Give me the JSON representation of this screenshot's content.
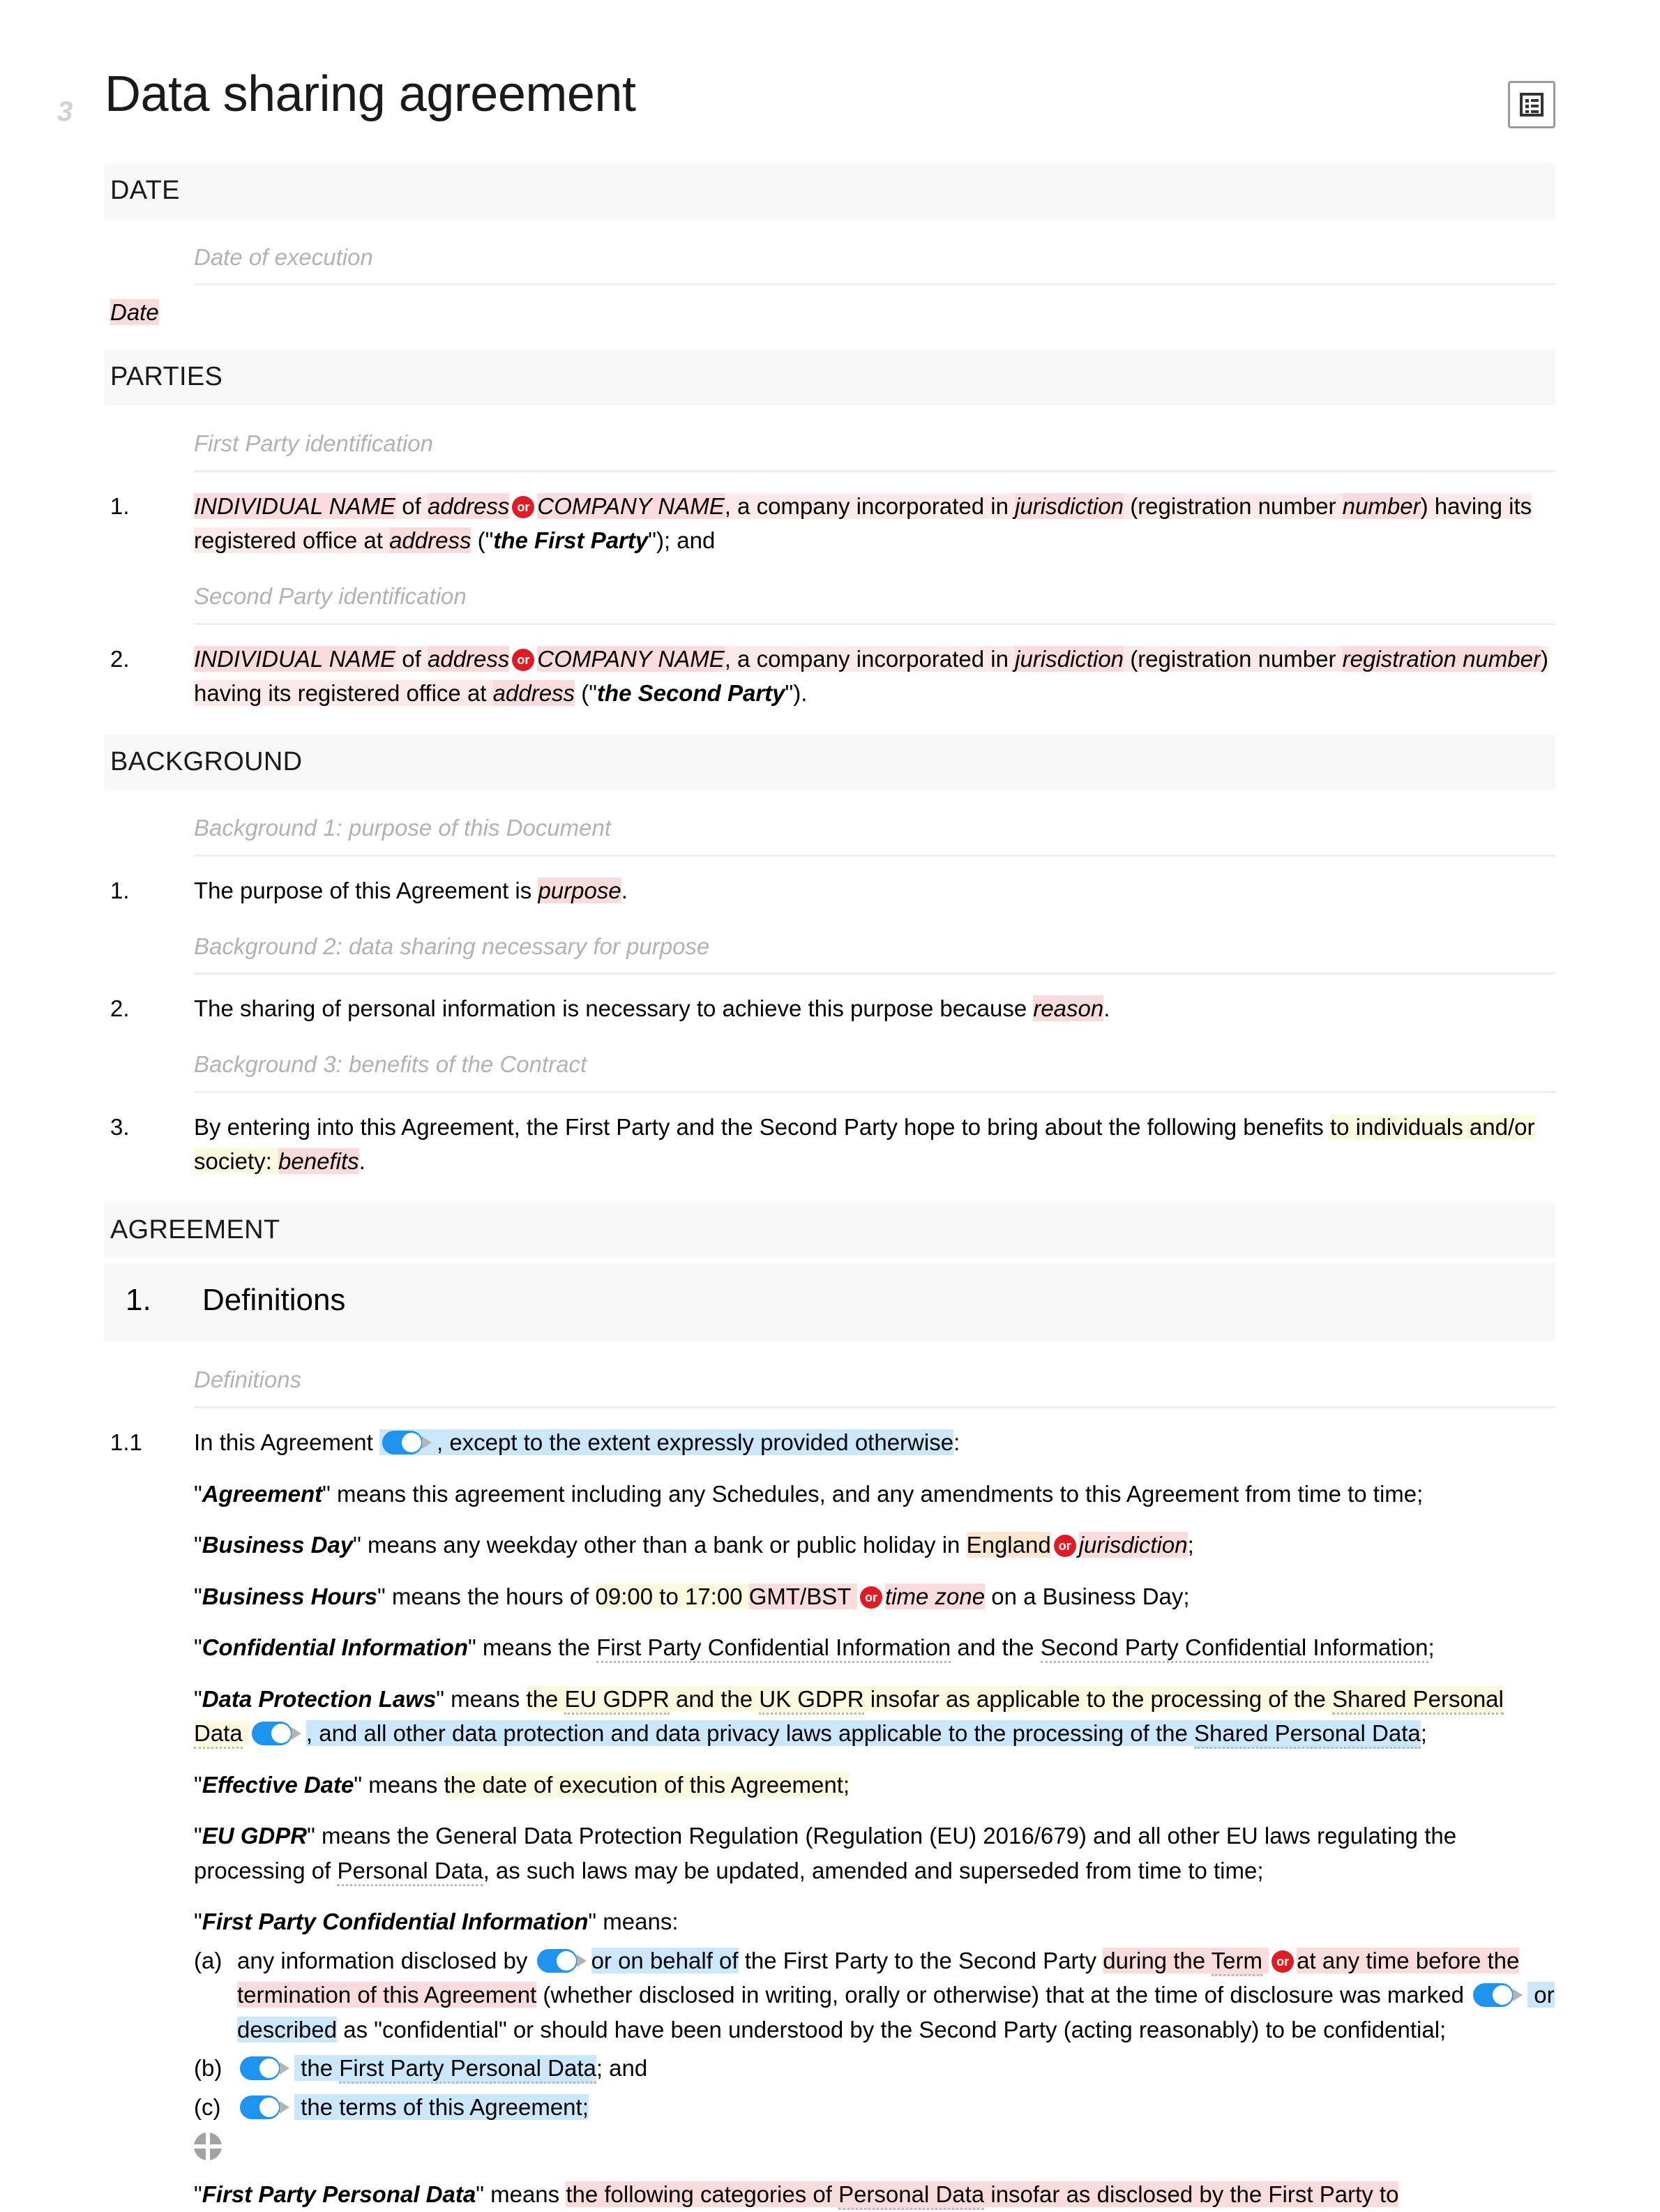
{
  "document": {
    "page_number_margin": "3",
    "title": "Data sharing agreement",
    "header_icon": "document-list-icon"
  },
  "colors": {
    "accent_blue": "#1e93f0",
    "or_badge_red": "#e01b22",
    "highlight_pink": "#fadcdc",
    "highlight_pink_light": "#fce9e9",
    "highlight_yellow": "#fbfadf",
    "highlight_orange": "#fbe6d0",
    "highlight_blue": "#cbe7fb",
    "band_grey": "#f8f8f8",
    "comment_grey": "#b2b2b2"
  },
  "sections": {
    "date": {
      "band": "DATE",
      "comment": "Date of execution",
      "value": "Date"
    },
    "parties": {
      "band": "PARTIES",
      "first_party": {
        "comment": "First Party identification",
        "marker": "1.",
        "p1": "INDIVIDUAL NAME",
        "p2": " of ",
        "p3": "address",
        "or": "or",
        "p4": "COMPANY NAME",
        "p5": ", a company incorporated in ",
        "p6": "jurisdiction",
        "p7": " (registration number ",
        "p8": "number",
        "p9": ")",
        "p10": " having its registered office at ",
        "p11": "address",
        "p12": " (\"",
        "p13": "the First Party",
        "p14": "\"); and"
      },
      "second_party": {
        "comment": "Second Party identification",
        "marker": "2.",
        "p1": "INDIVIDUAL NAME",
        "p2": " of ",
        "p3": "address",
        "or": "or",
        "p4": "COMPANY NAME",
        "p5": ", a company incorporated in ",
        "p6": "jurisdiction",
        "p7": " (registration number ",
        "p8": "registration number",
        "p9": ")",
        "p10": " having its registered office at ",
        "p11": "address",
        "p12": " (\"",
        "p13": "the Second Party",
        "p14": "\")."
      }
    },
    "background": {
      "band": "BACKGROUND",
      "items": [
        {
          "comment": "Background 1: purpose of this Document",
          "marker": "1.",
          "pre": "The purpose of this Agreement is ",
          "placeholder": "purpose",
          "post": "."
        },
        {
          "comment": "Background 2: data sharing necessary for purpose",
          "marker": "2.",
          "pre": "The sharing of personal information is necessary to achieve this purpose because ",
          "placeholder": "reason",
          "post": "."
        },
        {
          "comment": "Background 3: benefits of the Contract",
          "marker": "3.",
          "pre": "By entering into this Agreement, the First Party and the Second Party hope to bring about the following benefits ",
          "highlight_yellow": "to individuals and/or society: ",
          "placeholder": "benefits",
          "post": "."
        }
      ]
    },
    "agreement": {
      "band": "AGREEMENT",
      "clause": {
        "number": "1.",
        "title": "Definitions"
      },
      "comment": "Definitions",
      "lead": {
        "marker": "1.1",
        "pre": "In this Agreement ",
        "toggle": "toggle-switch-on",
        "highlight_blue": ", except to the extent expressly provided otherwise",
        "post": ":"
      },
      "definitions": [
        {
          "term": "Agreement",
          "parts": [
            {
              "t": "\"",
              "s": "q"
            },
            {
              "t": "Agreement",
              "s": "term"
            },
            {
              "t": "\" means this agreement including any Schedules, and any amendments to this Agreement from time to time;",
              "s": "n"
            }
          ]
        },
        {
          "term": "Business Day",
          "parts": [
            {
              "t": "\"",
              "s": "q"
            },
            {
              "t": "Business Day",
              "s": "term"
            },
            {
              "t": "\" means any weekday other than a bank or public holiday in ",
              "s": "n"
            },
            {
              "t": "England",
              "s": "hl-orange"
            },
            {
              "t": "or",
              "s": "or"
            },
            {
              "t": "jurisdiction",
              "s": "hl-pink-i"
            },
            {
              "t": ";",
              "s": "n"
            }
          ]
        },
        {
          "term": "Business Hours",
          "parts": [
            {
              "t": "\"",
              "s": "q"
            },
            {
              "t": "Business Hours",
              "s": "term"
            },
            {
              "t": "\" means the hours of ",
              "s": "n"
            },
            {
              "t": "09:00 to 17:00 ",
              "s": "hl-yellow"
            },
            {
              "t": "GMT/BST ",
              "s": "hl-pink"
            },
            {
              "t": "or",
              "s": "or"
            },
            {
              "t": "time zone",
              "s": "hl-pink-i"
            },
            {
              "t": " on a Business Day;",
              "s": "n"
            }
          ]
        },
        {
          "term": "Confidential Information",
          "parts": [
            {
              "t": "\"",
              "s": "q"
            },
            {
              "t": "Confidential Information",
              "s": "term"
            },
            {
              "t": "\" means the ",
              "s": "n"
            },
            {
              "t": "First Party Confidential Information",
              "s": "dotted"
            },
            {
              "t": " and the ",
              "s": "n"
            },
            {
              "t": "Second Party Confidential Information",
              "s": "dotted"
            },
            {
              "t": ";",
              "s": "n"
            }
          ]
        },
        {
          "term": "Data Protection Laws",
          "parts": [
            {
              "t": "\"",
              "s": "q"
            },
            {
              "t": "Data Protection Laws",
              "s": "term"
            },
            {
              "t": "\" means ",
              "s": "n"
            },
            {
              "t": "the ",
              "s": "hl-yellow"
            },
            {
              "t": "EU GDPR",
              "s": "hl-yellow-dotted"
            },
            {
              "t": " and the ",
              "s": "hl-yellow"
            },
            {
              "t": "UK GDPR",
              "s": "hl-yellow-dotted"
            },
            {
              "t": " insofar as applicable to the processing of the ",
              "s": "hl-yellow"
            },
            {
              "t": "Shared Personal Data",
              "s": "hl-yellow-dotted"
            },
            {
              "t": " ",
              "s": "hl-yellow"
            },
            {
              "t": "toggle",
              "s": "toggle-blue"
            },
            {
              "t": ", and all other data protection and data privacy laws applicable to the processing of the ",
              "s": "hl-blue"
            },
            {
              "t": "Shared Personal Data",
              "s": "hl-blue-dotted"
            },
            {
              "t": ";",
              "s": "n"
            }
          ]
        },
        {
          "term": "Effective Date",
          "parts": [
            {
              "t": "\"",
              "s": "q"
            },
            {
              "t": "Effective Date",
              "s": "term"
            },
            {
              "t": "\" means ",
              "s": "n"
            },
            {
              "t": "the date of execution of this Agreement;",
              "s": "hl-yellow"
            }
          ]
        },
        {
          "term": "EU GDPR",
          "parts": [
            {
              "t": "\"",
              "s": "q"
            },
            {
              "t": "EU GDPR",
              "s": "term"
            },
            {
              "t": "\" means the General Data Protection Regulation (Regulation (EU) 2016/679) and all other EU laws regulating the processing of ",
              "s": "n"
            },
            {
              "t": "Personal Data",
              "s": "dotted"
            },
            {
              "t": ", as such laws may be updated, amended and superseded from time to time;",
              "s": "n"
            }
          ]
        }
      ],
      "first_party_confidential": {
        "heading": {
          "q1": "\"",
          "term": "First Party Confidential Information",
          "q2": "\" means:"
        },
        "items": [
          {
            "marker": "(a)",
            "parts": [
              {
                "t": "any information disclosed by ",
                "s": "n"
              },
              {
                "t": "toggle",
                "s": "toggle-blue"
              },
              {
                "t": "or on behalf of",
                "s": "hl-blue"
              },
              {
                "t": " the First Party to the Second Party ",
                "s": "n"
              },
              {
                "t": "during the ",
                "s": "hl-pink"
              },
              {
                "t": "Term",
                "s": "hl-pink-dotted"
              },
              {
                "t": " ",
                "s": "hl-pink"
              },
              {
                "t": "or",
                "s": "or"
              },
              {
                "t": "at any time before the termination of this Agreement",
                "s": "hl-pink"
              },
              {
                "t": " (whether disclosed in writing, orally or otherwise) that at the time of disclosure was marked ",
                "s": "n"
              },
              {
                "t": "toggle",
                "s": "toggle-blue"
              },
              {
                "t": " or described",
                "s": "hl-blue"
              },
              {
                "t": " as \"confidential\" or should have been understood by the Second Party (acting reasonably) to be confidential;",
                "s": "n"
              }
            ]
          },
          {
            "marker": "(b)",
            "parts": [
              {
                "t": "toggle",
                "s": "toggle-blue"
              },
              {
                "t": " the ",
                "s": "hl-blue"
              },
              {
                "t": "First Party Personal Data",
                "s": "hl-blue-dotted"
              },
              {
                "t": "; and",
                "s": "n"
              }
            ]
          },
          {
            "marker": "(c)",
            "parts": [
              {
                "t": "toggle",
                "s": "toggle-blue"
              },
              {
                "t": " the terms of this Agreement;",
                "s": "hl-blue"
              }
            ]
          }
        ],
        "move_handle": "move-handle-icon"
      },
      "first_party_personal_data": {
        "parts": [
          {
            "t": "\"",
            "s": "q"
          },
          {
            "t": "First Party Personal Data",
            "s": "term"
          },
          {
            "t": "\" means ",
            "s": "n"
          },
          {
            "t": "the following categories of ",
            "s": "hl-pink"
          },
          {
            "t": "Personal Data",
            "s": "hl-pink-dotted"
          },
          {
            "t": " insofar as disclosed by the First Party to",
            "s": "hl-pink"
          }
        ]
      }
    }
  }
}
